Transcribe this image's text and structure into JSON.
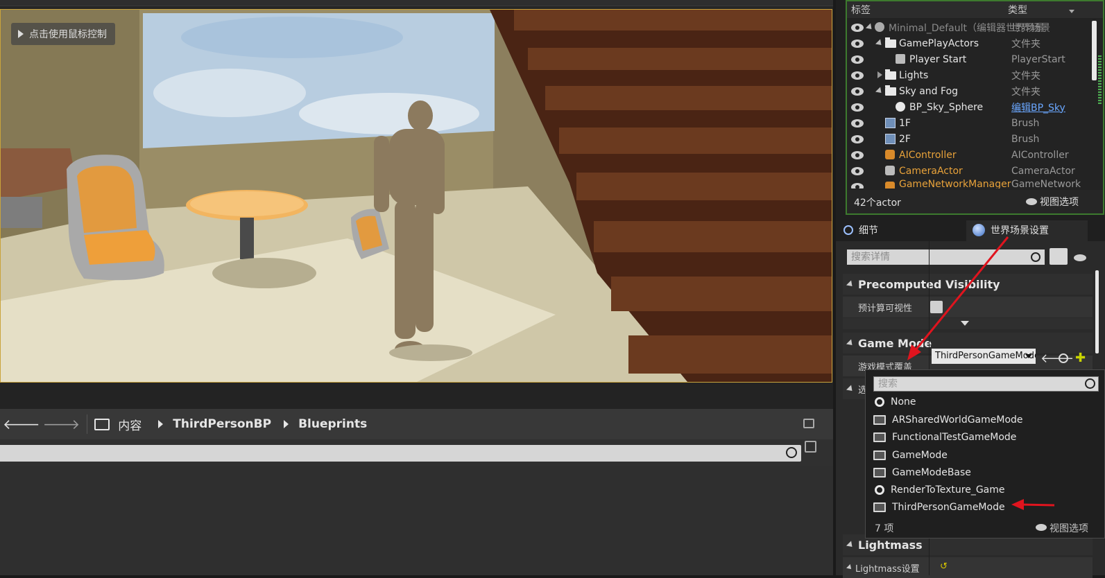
{
  "viewport": {
    "hint": "点击使用鼠标控制"
  },
  "content_browser": {
    "breadcrumb": [
      "内容",
      "ThirdPersonBP",
      "Blueprints"
    ]
  },
  "outliner": {
    "col_label": "标签",
    "col_type": "类型",
    "rows": [
      {
        "name": "Minimal_Default（编辑器世界场景",
        "type": "",
        "style": "dim"
      },
      {
        "name": "GamePlayActors",
        "type": "文件夹"
      },
      {
        "name": "Player Start",
        "type": "PlayerStart"
      },
      {
        "name": "Lights",
        "type": "文件夹"
      },
      {
        "name": "Sky and Fog",
        "type": "文件夹"
      },
      {
        "name": "BP_Sky_Sphere",
        "type": "编辑BP_Sky"
      },
      {
        "name": "1F",
        "type": "Brush"
      },
      {
        "name": "2F",
        "type": "Brush"
      },
      {
        "name": "AIController",
        "type": "AIController"
      },
      {
        "name": "CameraActor",
        "type": "CameraActor"
      },
      {
        "name": "GameNetworkManager",
        "type": "GameNetwork"
      }
    ],
    "root_type": "世界场景",
    "count": "42个actor",
    "view_options": "视图选项"
  },
  "details": {
    "tab_details": "细节",
    "tab_world": "世界场景设置",
    "search_placeholder": "搜索详情",
    "section_precomputed": "Precomputed Visibility",
    "prop_precomputed": "预计算可视性",
    "section_gamemode": "Game Mode",
    "prop_gamemode": "游戏模式覆盖",
    "gamemode_value": "ThirdPersonGameMode",
    "partial_label": "选",
    "section_lightmass": "Lightmass",
    "prop_lightmass": "Lightmass设置"
  },
  "dropdown": {
    "search_placeholder": "搜索",
    "items": [
      {
        "label": "None",
        "icon": "circle"
      },
      {
        "label": "ARSharedWorldGameMode",
        "icon": "monitor"
      },
      {
        "label": "FunctionalTestGameMode",
        "icon": "monitor"
      },
      {
        "label": "GameMode",
        "icon": "monitor"
      },
      {
        "label": "GameModeBase",
        "icon": "monitor"
      },
      {
        "label": "RenderToTexture_Game",
        "icon": "circle"
      },
      {
        "label": "ThirdPersonGameMode",
        "icon": "monitor"
      }
    ],
    "count": "7 项",
    "view_options": "视图选项"
  }
}
